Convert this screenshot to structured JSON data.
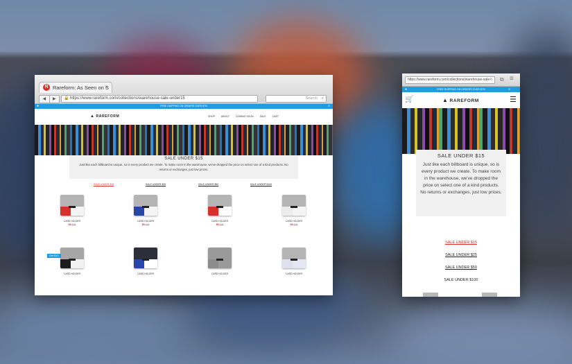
{
  "desktop": {
    "tab_title": "Rareform: As Seen on S",
    "tab_close": "×",
    "favicon": "R",
    "back": "◀",
    "forward": "▶",
    "url": "https://www.rareform.com/collections/warehouse-sale-under15",
    "search_placeholder": "Search",
    "shipping_banner": "FREE SHIPPING ON ORDERS OVER $75!",
    "logo": "RAREFORM",
    "nav": [
      "SHOP",
      "ABOUT",
      "COMING SOON",
      "SALE",
      "CART"
    ],
    "heading": "SALE UNDER $15",
    "description": "Just like each billboard is unique, so is every product we create. To make room in the warehouse, we've dropped the price on select one of a kind products. No returns or exchanges, just low prices.",
    "filters": [
      "SALE UNDER $15",
      "SALE UNDER $25",
      "SALE UNDER $50",
      "SALE UNDER $100"
    ],
    "badge": "Get $10",
    "products": [
      {
        "name": "CARD HOLDER",
        "price": "$8",
        "was": "$28",
        "top": "#b4b4b4",
        "bottom": "#f4f4f4",
        "accent": "#d9302b"
      },
      {
        "name": "CARD HOLDER",
        "price": "$8",
        "was": "$28",
        "top": "#b4b4b4",
        "bottom": "#f4f4f4",
        "accent": "#2747a8"
      },
      {
        "name": "CARD HOLDER",
        "price": "$8",
        "was": "$28",
        "top": "#b4b4b4",
        "bottom": "#ffffff",
        "accent": "#d9302b"
      },
      {
        "name": "CARD HOLDER",
        "price": "$8",
        "was": "$28",
        "top": "#b4b4b4",
        "bottom": "#f4f4f4",
        "accent": "#ececec"
      },
      {
        "name": "CARD HOLDER",
        "price": "",
        "was": "",
        "top": "#a6a6a6",
        "bottom": "#f2f2f2",
        "accent": "#1c1c1c"
      },
      {
        "name": "CARD HOLDER",
        "price": "",
        "was": "",
        "top": "#2c2f3a",
        "bottom": "#ffffff",
        "accent": "#2747a8"
      },
      {
        "name": "CARD HOLDER",
        "price": "",
        "was": "",
        "top": "#9a9a9a",
        "bottom": "#9a9a9a",
        "accent": "#8c8c8c"
      },
      {
        "name": "CARD HOLDER",
        "price": "",
        "was": "",
        "top": "#b4b4b4",
        "bottom": "#e4e6f2",
        "accent": "#dfe0ee"
      }
    ]
  },
  "mobile": {
    "url": "https://www.rareform.com/collections/warehouse-sale-",
    "shipping_banner": "FREE SHIPPING ON ORDERS OVER $75!",
    "logo": "RAREFORM",
    "heading": "SALE UNDER $15",
    "description": "Just like each billboard is unique, so is every product we create. To make room in the warehouse, we've dropped the price on select one of a kind products. No returns or exchanges, just low prices.",
    "filters": [
      "SALE UNDER $15",
      "SALE UNDER $25",
      "SALE UNDER $50",
      "SALE UNDER $100"
    ]
  },
  "colors": {
    "accent": "#1f9be0",
    "sale": "#d9302b"
  }
}
